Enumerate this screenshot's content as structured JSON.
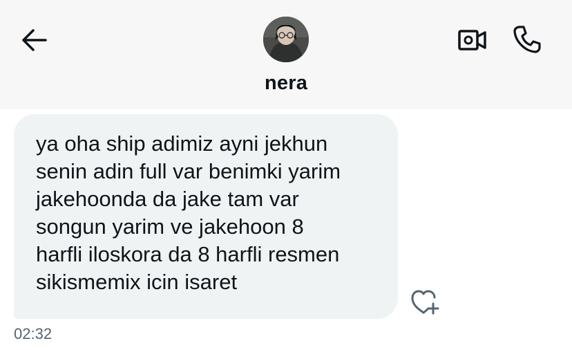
{
  "header": {
    "back_icon": "arrow-left-icon",
    "contact_name": "nera",
    "video_icon": "video-camera-icon",
    "phone_icon": "phone-icon"
  },
  "message": {
    "text": "ya oha ship adimiz ayni jekhun\nsenin adin full var benimki yarim\njakehoonda da jake tam var\nsongun yarim ve jakehoon 8\nharfli iloskora da 8 harfli resmen\nsikismemix icin isaret",
    "timestamp": "02:32",
    "react_icon": "heart-plus-icon"
  },
  "colors": {
    "header_bg": "#f7f7f7",
    "bubble_bg": "#eff3f4",
    "text": "#0f1419",
    "muted": "#536471"
  }
}
